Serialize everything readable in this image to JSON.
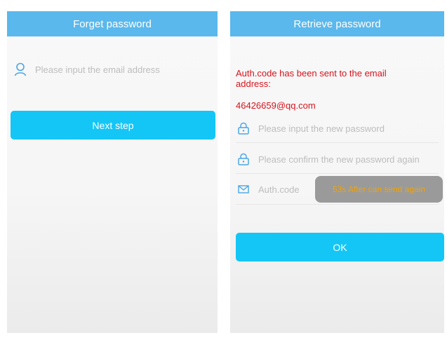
{
  "forget_screen": {
    "title": "Forget password",
    "email_placeholder": "Please input the email address",
    "next_label": "Next step"
  },
  "retrieve_screen": {
    "title": "Retrieve password",
    "notice_line1": "Auth.code has been sent to the email",
    "notice_line2": "address:",
    "email": "46426659@qq.com",
    "new_password_placeholder": "Please input the new password",
    "confirm_password_placeholder": "Please confirm the new password again",
    "auth_code_placeholder": "Auth.code",
    "resend_label": "53s After can send again",
    "ok_label": "OK"
  },
  "colors": {
    "titlebar": "#5ab8ec",
    "primary_button": "#14c6f5",
    "notice_text": "#d7131b",
    "resend_text": "#f4a300",
    "icon": "#4aa6e6"
  }
}
